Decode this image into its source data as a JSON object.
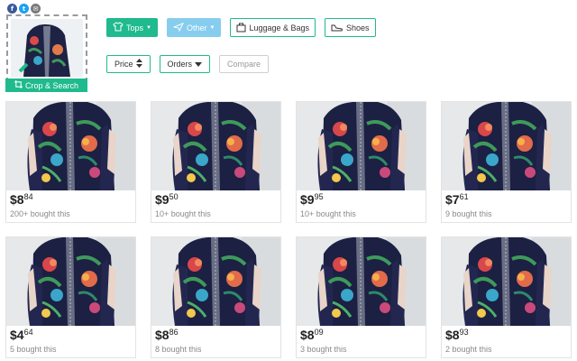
{
  "share": [
    {
      "name": "facebook",
      "glyph": "f",
      "color": "#3b5998"
    },
    {
      "name": "twitter",
      "glyph": "t",
      "color": "#1da1f2"
    },
    {
      "name": "email",
      "glyph": "✉",
      "color": "#7a7a7a"
    }
  ],
  "crop": {
    "label": "Crop & Search",
    "icon": "crop-icon"
  },
  "categories": [
    {
      "label": "Tops",
      "icon": "shirt-icon",
      "state": "active",
      "caret": true
    },
    {
      "label": "Other",
      "icon": "plane-icon",
      "state": "soft",
      "caret": true
    },
    {
      "label": "Luggage & Bags",
      "icon": "bag-icon",
      "state": "outline",
      "caret": false
    },
    {
      "label": "Shoes",
      "icon": "shoe-icon",
      "state": "outline",
      "caret": false
    }
  ],
  "sorts": {
    "price_label": "Price",
    "orders_label": "Orders",
    "compare_label": "Compare"
  },
  "colors": {
    "accent": "#1fba8d",
    "soft": "#86cdee"
  },
  "products": [
    {
      "dollars": "$8",
      "cents": "84",
      "sold": "200+ bought this"
    },
    {
      "dollars": "$9",
      "cents": "50",
      "sold": "10+ bought this"
    },
    {
      "dollars": "$9",
      "cents": "95",
      "sold": "10+ bought this"
    },
    {
      "dollars": "$7",
      "cents": "61",
      "sold": "9 bought this"
    },
    {
      "dollars": "$4",
      "cents": "64",
      "sold": "5 bought this"
    },
    {
      "dollars": "$8",
      "cents": "86",
      "sold": "8 bought this"
    },
    {
      "dollars": "$8",
      "cents": "09",
      "sold": "3 bought this"
    },
    {
      "dollars": "$8",
      "cents": "93",
      "sold": "2 bought this"
    }
  ]
}
